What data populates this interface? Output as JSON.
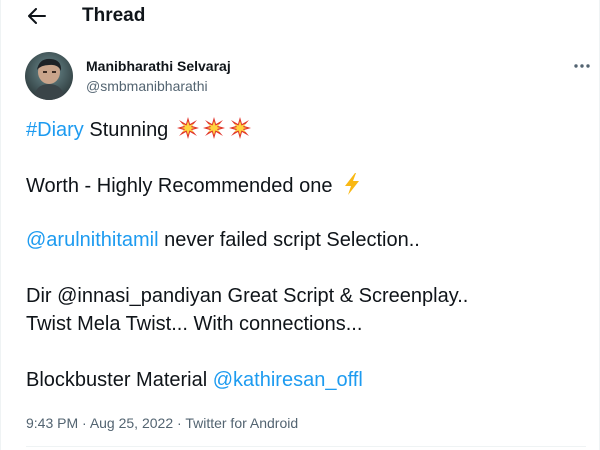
{
  "header": {
    "title": "Thread",
    "back_icon": "arrow-left-icon"
  },
  "author": {
    "display_name": "Manibharathi Selvaraj",
    "handle": "@smbmanibharathi",
    "avatar_icon": "avatar"
  },
  "more_icon": "more-horizontal-icon",
  "tweet": {
    "line1": {
      "hashtag": "#Diary",
      "text": " Stunning ",
      "emoji": "collision-emoji",
      "emoji_count": 3
    },
    "line2": {
      "text": "Worth - Highly Recommended one ",
      "emoji": "lightning-emoji"
    },
    "line3": {
      "mention": "@arulnithitamil",
      "text": " never failed script Selection.."
    },
    "line4": {
      "text": "Dir @innasi_pandiyan Great Script & Screenplay.."
    },
    "line5": {
      "text": "Twist Mela Twist...  With connections..."
    },
    "line6": {
      "text": "Blockbuster Material ",
      "mention": "@kathiresan_offl"
    }
  },
  "meta": {
    "time": "9:43 PM",
    "sep1": " · ",
    "date": "Aug 25, 2022",
    "sep2": " · ",
    "source": "Twitter for Android"
  },
  "colors": {
    "link": "#1d9bf0",
    "text": "#0f1419",
    "secondary": "#536471",
    "divider": "#eff3f4"
  }
}
